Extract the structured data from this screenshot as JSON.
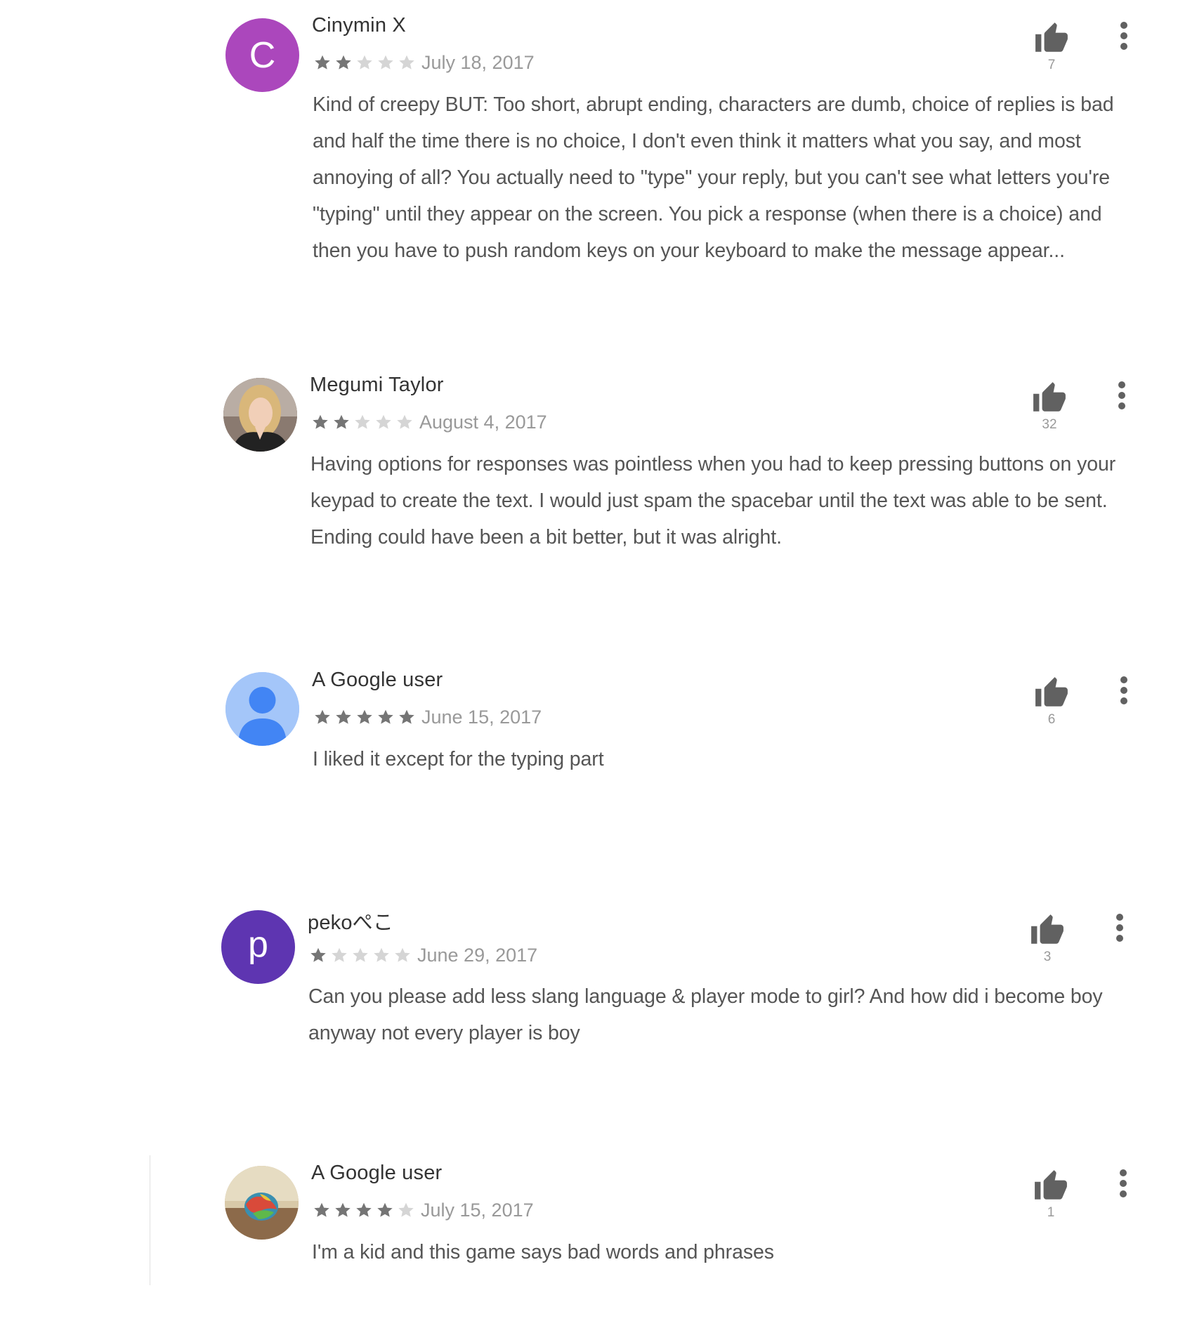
{
  "colors": {
    "star_filled": "#757575",
    "star_empty": "#d5d5d5",
    "icon_dark": "#616161",
    "avatar_c": "#ab47bc",
    "avatar_google": "#a4c6f9",
    "avatar_google_figure": "#4285f4",
    "avatar_p": "#5e35b1"
  },
  "reviews": [
    {
      "author": "Cinymin X",
      "avatar_letter": "C",
      "stars": 2,
      "date": "July 18, 2017",
      "text": "Kind of creepy BUT: Too short, abrupt ending, characters are dumb, choice of replies is bad\nand half the time there is no choice, I don't even think it matters what you say, and most\nannoying of all? You actually need to \"type\" your reply, but you can't see what letters you're\n\"typing\" until they appear on the screen. You pick a response (when there is a choice) and\nthen you have to push random keys on your keyboard to make the message appear...",
      "likes": "7"
    },
    {
      "author": "Megumi Taylor",
      "avatar_letter": "",
      "stars": 2,
      "date": "August 4, 2017",
      "text": "Having options for responses was pointless when you had to keep pressing buttons on your\nkeypad to create the text. I would just spam the spacebar until the text was able to be sent.\nEnding could have been a bit better, but it was alright.",
      "likes": "32"
    },
    {
      "author": "A Google user",
      "avatar_letter": "",
      "stars": 5,
      "date": "June 15, 2017",
      "text": "I liked it except for the typing part",
      "likes": "6"
    },
    {
      "author": "pekoぺこ",
      "avatar_letter": "p",
      "stars": 1,
      "date": "June 29, 2017",
      "text": "Can you please add less slang language & player mode to girl? And how did i become boy\nanyway not every player is boy",
      "likes": "3"
    },
    {
      "author": "A Google user",
      "avatar_letter": "",
      "stars": 4,
      "date": "July 15, 2017",
      "text": "I'm a kid and this game says bad words and phrases",
      "likes": "1"
    }
  ]
}
